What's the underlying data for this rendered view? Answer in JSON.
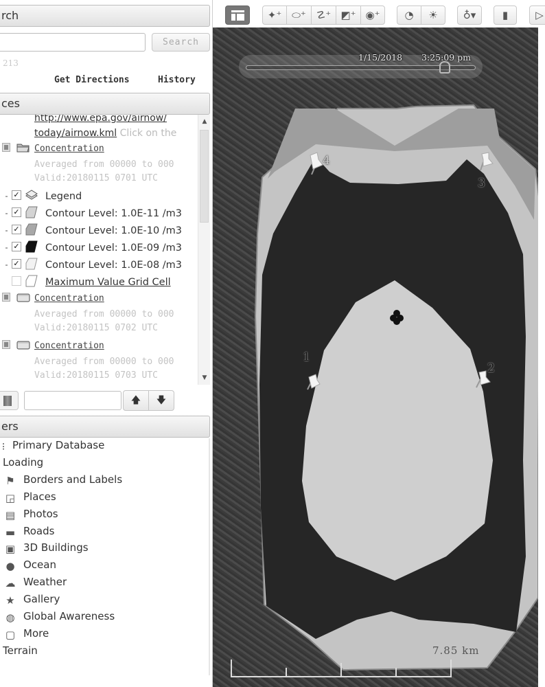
{
  "search": {
    "header": "rch",
    "input_value": "",
    "button_label": "Search",
    "hint": "213",
    "get_directions": "Get Directions",
    "history": "History"
  },
  "places": {
    "header": "ces",
    "items": [
      {
        "type": "url",
        "line1": "http://www.epa.gov/airnow/",
        "line2_link": "today/airnow.kml",
        "line2_rest": " Click on the"
      },
      {
        "type": "folder",
        "label": "Concentration ",
        "desc1": "Averaged from 00000 to 000",
        "desc2": "Valid:20180115 0701 UTC",
        "open": true
      },
      {
        "type": "layer",
        "label": "Legend",
        "checked": true,
        "icon": "legend-stack-icon"
      },
      {
        "type": "layer",
        "label": "Contour Level: 1.0E-11 /m3",
        "checked": true,
        "icon": "polygon-light-gray-icon",
        "fill": "#d4d4d4"
      },
      {
        "type": "layer",
        "label": "Contour Level: 1.0E-10 /m3",
        "checked": true,
        "icon": "polygon-mid-gray-icon",
        "fill": "#a8a8a8"
      },
      {
        "type": "layer",
        "label": "Contour Level: 1.0E-09 /m3",
        "checked": true,
        "icon": "polygon-black-icon",
        "fill": "#111111"
      },
      {
        "type": "layer",
        "label": "Contour Level: 1.0E-08 /m3",
        "checked": true,
        "icon": "polygon-white-icon",
        "fill": "#f2f2f2"
      },
      {
        "type": "layer",
        "label": "Maximum Value Grid Cell",
        "checked": false,
        "icon": "polygon-outline-icon",
        "fill": "#ffffff"
      },
      {
        "type": "folder",
        "label": "Concentration ",
        "desc1": "Averaged from 00000 to 000",
        "desc2": "Valid:20180115 0702 UTC",
        "open": false
      },
      {
        "type": "folder",
        "label": "Concentration ",
        "desc1": "Averaged from 00000 to 000",
        "desc2": "Valid:20180115 0703 UTC",
        "open": false
      }
    ],
    "filter_value": "",
    "up_arrow": "🡅",
    "down_arrow": "🡇"
  },
  "layers": {
    "header": "ers",
    "items": [
      {
        "label": "Primary Database",
        "icon": "database-icon",
        "glyph": "⁝",
        "indent": "partial"
      },
      {
        "label": "Loading",
        "icon": "",
        "glyph": "",
        "indent": "none"
      },
      {
        "label": "Borders and Labels",
        "icon": "flag-icon",
        "glyph": "⚑"
      },
      {
        "label": "Places",
        "icon": "places-icon",
        "glyph": "◲"
      },
      {
        "label": "Photos",
        "icon": "photos-icon",
        "glyph": "▤"
      },
      {
        "label": "Roads",
        "icon": "roads-icon",
        "glyph": "▬"
      },
      {
        "label": "3D Buildings",
        "icon": "buildings-icon",
        "glyph": "▣"
      },
      {
        "label": "Ocean",
        "icon": "ocean-globe-icon",
        "glyph": "●"
      },
      {
        "label": "Weather",
        "icon": "weather-icon",
        "glyph": "☁"
      },
      {
        "label": "Gallery",
        "icon": "star-icon",
        "glyph": "★"
      },
      {
        "label": "Global Awareness",
        "icon": "globe-icon",
        "glyph": "◍"
      },
      {
        "label": "More",
        "icon": "more-note-icon",
        "glyph": "▢"
      },
      {
        "label": "Terrain",
        "icon": "",
        "glyph": "",
        "indent": "none"
      }
    ]
  },
  "toolbar": {
    "buttons": [
      {
        "name": "toggle-sidebar-button",
        "glyph": ""
      },
      {
        "name": "add-placemark-button",
        "glyph": "✦⁺"
      },
      {
        "name": "add-polygon-button",
        "glyph": "⬭⁺"
      },
      {
        "name": "add-path-button",
        "glyph": "☡⁺"
      },
      {
        "name": "add-image-overlay-button",
        "glyph": "◩⁺"
      },
      {
        "name": "record-tour-button",
        "glyph": "◉⁺"
      },
      {
        "name": "historical-imagery-button",
        "glyph": "◔"
      },
      {
        "name": "sunlight-button",
        "glyph": "☀"
      },
      {
        "name": "switch-planet-button",
        "glyph": "♁▾"
      },
      {
        "name": "ruler-button",
        "glyph": "▮"
      },
      {
        "name": "email-button",
        "glyph": "▷"
      }
    ]
  },
  "map": {
    "time_slider": {
      "date": "1/15/2018",
      "time": "3:25:09 pm",
      "position_fraction": 0.88
    },
    "markers": [
      {
        "id": "1",
        "label": "1"
      },
      {
        "id": "2",
        "label": "2"
      },
      {
        "id": "3",
        "label": "3"
      },
      {
        "id": "4",
        "label": "4"
      }
    ],
    "scale_label": "7.85 km",
    "contour_colors": {
      "outer": "#c4c4c4",
      "band_10": "#9e9e9e",
      "band_09": "#262626",
      "core_08": "#cfcfcf",
      "max_cell": "#111111"
    }
  }
}
